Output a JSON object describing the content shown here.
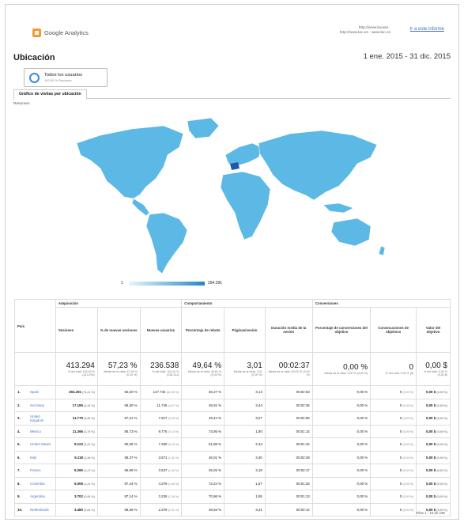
{
  "header": {
    "product": "Google Analytics",
    "url_text": "http://www.lacasa · http://www.lac.es · www.lac.es",
    "link": "Ir a este informe"
  },
  "page": {
    "title": "Ubicación",
    "date_range": "1 ene. 2015 - 31 dic. 2015"
  },
  "segment": {
    "label": "Todos los usuarios",
    "sub": "100,00 % Sesiones"
  },
  "tabs": [
    {
      "label": "Gráfico de visitas por ubicación"
    }
  ],
  "summary_label": "Resumen",
  "legend": {
    "min": "1",
    "max": "294.291"
  },
  "colors": {
    "map_land": "#5cb8e4",
    "map_highlight": "#1e5aa8",
    "accent": "#3a8bd9"
  },
  "table": {
    "groups": {
      "country": "País",
      "acq": "Adquisición",
      "behavior": "Comportamiento",
      "conv": "Conversiones"
    },
    "columns": [
      "Sesiones",
      "% de nuevas sesiones",
      "Nuevos usuarios",
      "Porcentaje de rebote",
      "Páginas/sesión",
      "Duración media de la sesión",
      "Porcentaje de conversiones del objetivo",
      "Consecuciones de objetivos",
      "Valor del objetivo"
    ],
    "totals": [
      {
        "value": "413.294",
        "sub": "% del total: 100,00 % (413.294)"
      },
      {
        "value": "57,23 %",
        "sub": "Media de la vista: 57,18 % (0,10 %)"
      },
      {
        "value": "236.538",
        "sub": "% del total: 100,10 % (236.311)"
      },
      {
        "value": "49,64 %",
        "sub": "Media de la vista: 49,64 % (0,00 %)"
      },
      {
        "value": "3,01",
        "sub": "Media de la vista: 3,01 (0,00 %)"
      },
      {
        "value": "00:02:37",
        "sub": "Media de la vista: 00:02:37 (0,00 %)"
      },
      {
        "value": "0,00 %",
        "sub": "Media de la vista: 0,00 % (0,00 %)"
      },
      {
        "value": "0",
        "sub": "% del total: 0,00 % (0)"
      },
      {
        "value": "0,00 $",
        "sub": "% del total: 0,00 % (0,00 $)"
      }
    ],
    "rows": [
      {
        "idx": "1.",
        "country": "Spain",
        "sessions": "294.291",
        "sessions_pct": "(71,21 %)",
        "new_pct": "50,20 %",
        "new_users": "147.734",
        "new_users_pct": "(62,46 %)",
        "bounce": "46,27 %",
        "pages": "3,13",
        "duration": "00:02:53",
        "conv": "0,00 %",
        "goals": "0",
        "goals_pct": "(0,00 %)",
        "value": "0,00 $",
        "value_pct": "(0,00 %)"
      },
      {
        "idx": "2.",
        "country": "Germany",
        "sessions": "17.195",
        "sessions_pct": "(4,16 %)",
        "new_pct": "68,30 %",
        "new_users": "11.745",
        "new_users_pct": "(4,97 %)",
        "bounce": "45,91 %",
        "pages": "3,44",
        "duration": "00:02:36",
        "conv": "0,00 %",
        "goals": "0",
        "goals_pct": "(0,00 %)",
        "value": "0,00 $",
        "value_pct": "(0,00 %)"
      },
      {
        "idx": "3.",
        "country": "United Kingdom",
        "sessions": "11.779",
        "sessions_pct": "(2,85 %)",
        "new_pct": "67,21 %",
        "new_users": "7.917",
        "new_users_pct": "(3,35 %)",
        "bounce": "49,44 %",
        "pages": "3,07",
        "duration": "00:02:06",
        "conv": "0,00 %",
        "goals": "0",
        "goals_pct": "(0,00 %)",
        "value": "0,00 $",
        "value_pct": "(0,00 %)"
      },
      {
        "idx": "4.",
        "country": "Mexico",
        "sessions": "11.366",
        "sessions_pct": "(2,75 %)",
        "new_pct": "85,73 %",
        "new_users": "9.776",
        "new_users_pct": "(4,13 %)",
        "bounce": "73,95 %",
        "pages": "1,80",
        "duration": "00:01:14",
        "conv": "0,00 %",
        "goals": "0",
        "goals_pct": "(0,00 %)",
        "value": "0,00 $",
        "value_pct": "(0,00 %)"
      },
      {
        "idx": "5.",
        "country": "United States",
        "sessions": "9.123",
        "sessions_pct": "(2,21 %)",
        "new_pct": "80,35 %",
        "new_users": "7.330",
        "new_users_pct": "(3,10 %)",
        "bounce": "51,88 %",
        "pages": "2,43",
        "duration": "00:01:42",
        "conv": "0,00 %",
        "goals": "0",
        "goals_pct": "(0,00 %)",
        "value": "0,00 $",
        "value_pct": "(0,00 %)"
      },
      {
        "idx": "6.",
        "country": "Italy",
        "sessions": "6.118",
        "sessions_pct": "(1,48 %)",
        "new_pct": "58,37 %",
        "new_users": "3.571",
        "new_users_pct": "(1,51 %)",
        "bounce": "46,01 %",
        "pages": "3,30",
        "duration": "00:02:28",
        "conv": "0,00 %",
        "goals": "0",
        "goals_pct": "(0,00 %)",
        "value": "0,00 $",
        "value_pct": "(0,00 %)"
      },
      {
        "idx": "7.",
        "country": "France",
        "sessions": "5.265",
        "sessions_pct": "(1,27 %)",
        "new_pct": "66,99 %",
        "new_users": "3.527",
        "new_users_pct": "(1,49 %)",
        "bounce": "46,02 %",
        "pages": "3,18",
        "duration": "00:02:17",
        "conv": "0,00 %",
        "goals": "0",
        "goals_pct": "(0,00 %)",
        "value": "0,00 $",
        "value_pct": "(0,00 %)"
      },
      {
        "idx": "8.",
        "country": "Colombia",
        "sessions": "5.008",
        "sessions_pct": "(1,21 %)",
        "new_pct": "87,44 %",
        "new_users": "4.379",
        "new_users_pct": "(1,85 %)",
        "bounce": "72,24 %",
        "pages": "1,67",
        "duration": "00:01:25",
        "conv": "0,00 %",
        "goals": "0",
        "goals_pct": "(0,00 %)",
        "value": "0,00 $",
        "value_pct": "(0,00 %)"
      },
      {
        "idx": "9.",
        "country": "Argentina",
        "sessions": "3.702",
        "sessions_pct": "(0,90 %)",
        "new_pct": "87,14 %",
        "new_users": "3.226",
        "new_users_pct": "(1,36 %)",
        "bounce": "70,96 %",
        "pages": "1,95",
        "duration": "00:01:13",
        "conv": "0,00 %",
        "goals": "0",
        "goals_pct": "(0,00 %)",
        "value": "0,00 $",
        "value_pct": "(0,00 %)"
      },
      {
        "idx": "10.",
        "country": "Netherlands",
        "sessions": "3.480",
        "sessions_pct": "(0,84 %)",
        "new_pct": "68,36 %",
        "new_users": "2.379",
        "new_users_pct": "(1,01 %)",
        "bounce": "45,83 %",
        "pages": "3,31",
        "duration": "00:02:14",
        "conv": "0,00 %",
        "goals": "0",
        "goals_pct": "(0,00 %)",
        "value": "0,00 $",
        "value_pct": "(0,00 %)"
      }
    ]
  },
  "footer": "Filas 1 - 10 de 190"
}
